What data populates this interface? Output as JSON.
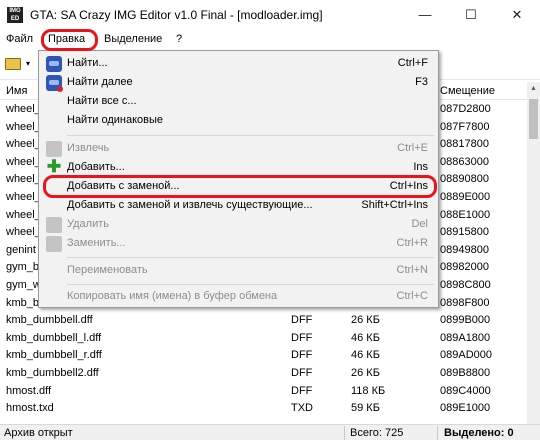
{
  "window": {
    "title": "GTA: SA Crazy IMG Editor v1.0 Final - [modloader.img]",
    "app_icon_text": "IMG ED",
    "minimize": "—",
    "maximize": "☐",
    "close": "✕"
  },
  "menubar": [
    "Файл",
    "Правка",
    "Выделение",
    "?"
  ],
  "highlight_color": "#e8141b",
  "toolbar": {
    "open_icon": "folder-open-icon",
    "dropdown_arrow": "▾"
  },
  "columns": {
    "name": "Имя",
    "offset": "Смещение"
  },
  "rows": [
    {
      "name": "wheel_",
      "type": "",
      "size": "",
      "offset": "087D2800"
    },
    {
      "name": "wheel_",
      "type": "",
      "size": "",
      "offset": "087F7800"
    },
    {
      "name": "wheel_",
      "type": "",
      "size": "",
      "offset": "08817800"
    },
    {
      "name": "wheel_",
      "type": "",
      "size": "",
      "offset": "08863000"
    },
    {
      "name": "wheel_",
      "type": "",
      "size": "",
      "offset": "08890800"
    },
    {
      "name": "wheel_",
      "type": "",
      "size": "",
      "offset": "0889E000"
    },
    {
      "name": "wheel_",
      "type": "",
      "size": "",
      "offset": "088E1000"
    },
    {
      "name": "wheel_",
      "type": "",
      "size": "",
      "offset": "08915800"
    },
    {
      "name": "genint",
      "type": "",
      "size": "",
      "offset": "08949800"
    },
    {
      "name": "gym_b",
      "type": "",
      "size": "",
      "offset": "08982000"
    },
    {
      "name": "gym_w",
      "type": "",
      "size": "",
      "offset": "0898C800"
    },
    {
      "name": "kmb_b",
      "type": "",
      "size": "",
      "offset": "0898F800"
    },
    {
      "name": "kmb_dumbbell.dff",
      "type": "DFF",
      "size": "26 КБ",
      "offset": "0899B000"
    },
    {
      "name": "kmb_dumbbell_l.dff",
      "type": "DFF",
      "size": "46 КБ",
      "offset": "089A1800"
    },
    {
      "name": "kmb_dumbbell_r.dff",
      "type": "DFF",
      "size": "46 КБ",
      "offset": "089AD000"
    },
    {
      "name": "kmb_dumbbell2.dff",
      "type": "DFF",
      "size": "26 КБ",
      "offset": "089B8800"
    },
    {
      "name": "hmost.dff",
      "type": "DFF",
      "size": "118 КБ",
      "offset": "089C4000"
    },
    {
      "name": "hmost.txd",
      "type": "TXD",
      "size": "59 КБ",
      "offset": "089E1000"
    }
  ],
  "status": {
    "archive": "Архив открыт",
    "total": "Всего: 725",
    "selected": "Выделено: 0"
  },
  "edit_menu": {
    "items": [
      {
        "label": "Найти...",
        "shortcut": "Ctrl+F",
        "disabled": false,
        "icon": "binoculars-icon"
      },
      {
        "label": "Найти далее",
        "shortcut": "F3",
        "disabled": false,
        "icon": "binoculars-next-icon"
      },
      {
        "label": "Найти все с...",
        "shortcut": "",
        "disabled": false,
        "icon": ""
      },
      {
        "label": "Найти одинаковые",
        "shortcut": "",
        "disabled": false,
        "icon": ""
      },
      {
        "label": "Извлечь",
        "shortcut": "Ctrl+E",
        "disabled": true,
        "icon": "extract-icon"
      },
      {
        "label": "Добавить...",
        "shortcut": "Ins",
        "disabled": false,
        "icon": "add-plus-icon"
      },
      {
        "label": "Добавить с заменой...",
        "shortcut": "Ctrl+Ins",
        "disabled": false,
        "icon": ""
      },
      {
        "label": "Добавить с заменой и извлечь существующие...",
        "shortcut": "Shift+Ctrl+Ins",
        "disabled": false,
        "icon": ""
      },
      {
        "label": "Удалить",
        "shortcut": "Del",
        "disabled": true,
        "icon": "delete-icon"
      },
      {
        "label": "Заменить...",
        "shortcut": "Ctrl+R",
        "disabled": true,
        "icon": "replace-icon"
      },
      {
        "label": "Переименовать",
        "shortcut": "Ctrl+N",
        "disabled": true,
        "icon": ""
      },
      {
        "label": "Копировать имя (имена) в буфер обмена",
        "shortcut": "Ctrl+C",
        "disabled": true,
        "icon": ""
      }
    ]
  }
}
